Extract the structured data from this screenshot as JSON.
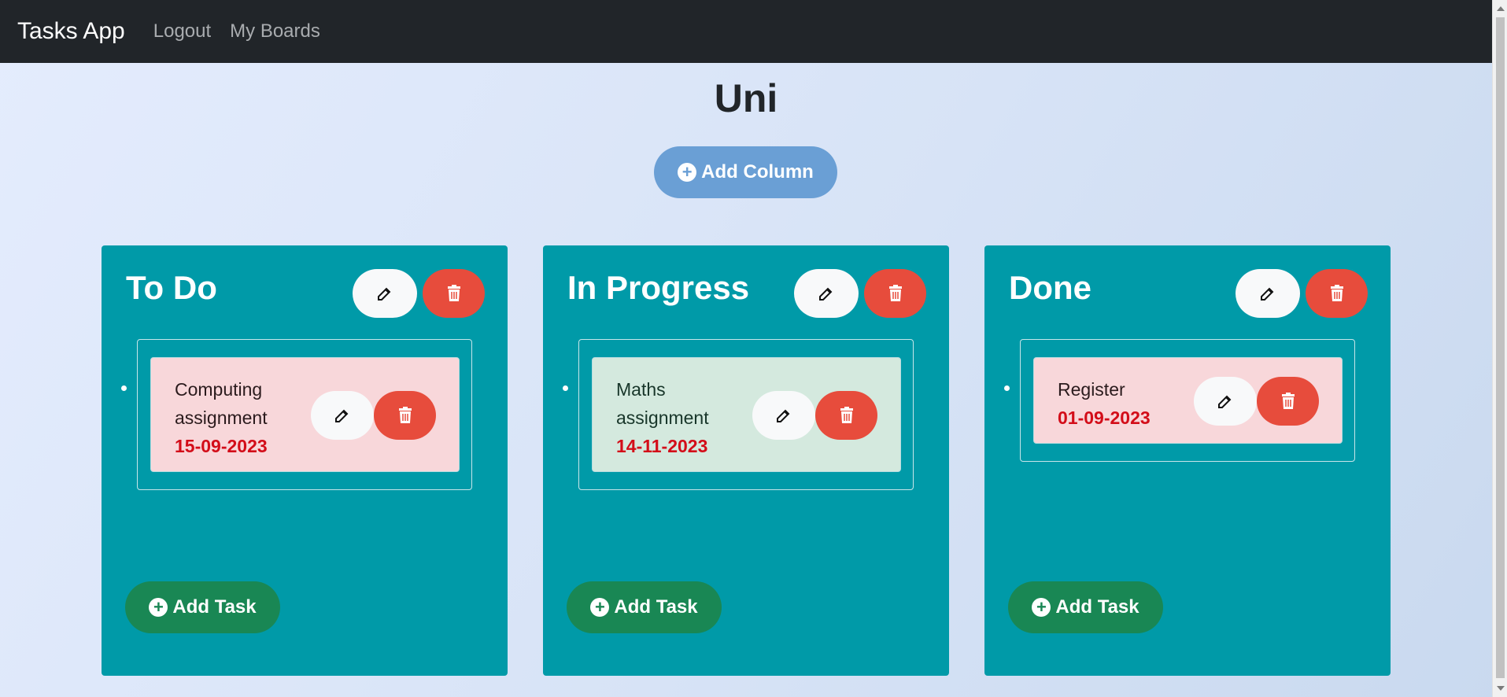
{
  "nav": {
    "brand": "Tasks App",
    "links": [
      "Logout",
      "My Boards"
    ]
  },
  "board": {
    "title": "Uni",
    "add_column_label": "Add Column"
  },
  "columns": [
    {
      "title": "To Do",
      "add_task_label": "Add Task",
      "tasks": [
        {
          "name": "Computing assignment",
          "date": "15-09-2023",
          "color": "#f8d7da"
        }
      ]
    },
    {
      "title": "In Progress",
      "add_task_label": "Add Task",
      "tasks": [
        {
          "name": "Maths assignment",
          "date": "14-11-2023",
          "color": "#d4e9de"
        }
      ]
    },
    {
      "title": "Done",
      "add_task_label": "Add Task",
      "tasks": [
        {
          "name": "Register",
          "date": "01-09-2023",
          "color": "#f8d7da"
        }
      ]
    }
  ],
  "icons": {
    "edit": "edit-icon",
    "delete": "trash-icon",
    "add": "plus-circle-icon"
  },
  "colors": {
    "navbar": "#212529",
    "column": "#009aa8",
    "delete": "#e74c3c",
    "add_task": "#198754",
    "add_column": "#6a9fd5",
    "date": "#d30d19"
  }
}
